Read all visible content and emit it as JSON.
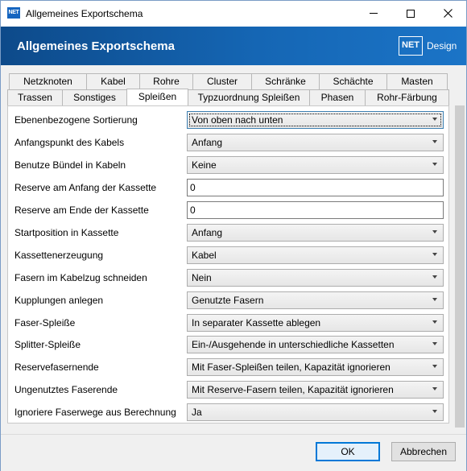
{
  "window": {
    "title": "Allgemeines Exportschema",
    "app_icon_text": "NET"
  },
  "header": {
    "title": "Allgemeines Exportschema",
    "logo_mark": "NET",
    "logo_text": "Design"
  },
  "tabs_row1": [
    {
      "label": "Netzknoten"
    },
    {
      "label": "Kabel"
    },
    {
      "label": "Rohre"
    },
    {
      "label": "Cluster"
    },
    {
      "label": "Schränke"
    },
    {
      "label": "Schächte"
    },
    {
      "label": "Masten"
    }
  ],
  "tabs_row2": [
    {
      "label": "Trassen"
    },
    {
      "label": "Sonstiges"
    },
    {
      "label": "Spleißen",
      "active": true
    },
    {
      "label": "Typzuordnung Spleißen"
    },
    {
      "label": "Phasen"
    },
    {
      "label": "Rohr-Färbung"
    }
  ],
  "fields": [
    {
      "label": "Ebenenbezogene Sortierung",
      "value": "Von oben nach unten",
      "kind": "combo"
    },
    {
      "label": "Anfangspunkt des Kabels",
      "value": "Anfang",
      "kind": "combo"
    },
    {
      "label": "Benutze Bündel in Kabeln",
      "value": "Keine",
      "kind": "combo"
    },
    {
      "label": "Reserve am Anfang der Kassette",
      "value": "0",
      "kind": "text"
    },
    {
      "label": "Reserve am Ende der Kassette",
      "value": "0",
      "kind": "text"
    },
    {
      "label": "Startposition in Kassette",
      "value": "Anfang",
      "kind": "combo"
    },
    {
      "label": "Kassettenerzeugung",
      "value": "Kabel",
      "kind": "combo"
    },
    {
      "label": "Fasern im Kabelzug schneiden",
      "value": "Nein",
      "kind": "combo"
    },
    {
      "label": "Kupplungen anlegen",
      "value": "Genutzte Fasern",
      "kind": "combo"
    },
    {
      "label": "Faser-Spleiße",
      "value": "In separater Kassette ablegen",
      "kind": "combo"
    },
    {
      "label": "Splitter-Spleiße",
      "value": "Ein-/Ausgehende in unterschiedliche Kassetten",
      "kind": "combo"
    },
    {
      "label": "Reservefasernende",
      "value": "Mit Faser-Spleißen teilen, Kapazität ignorieren",
      "kind": "combo"
    },
    {
      "label": "Ungenutztes Faserende",
      "value": "Mit Reserve-Fasern teilen, Kapazität ignorieren",
      "kind": "combo"
    },
    {
      "label": "Ignoriere Faserwege aus Berechnung",
      "value": "Ja",
      "kind": "combo"
    }
  ],
  "footer": {
    "ok_label": "OK",
    "cancel_label": "Abbrechen"
  },
  "colors": {
    "header_start": "#0d4a8a",
    "header_end": "#1b74c7",
    "default_button_border": "#0078d7"
  }
}
